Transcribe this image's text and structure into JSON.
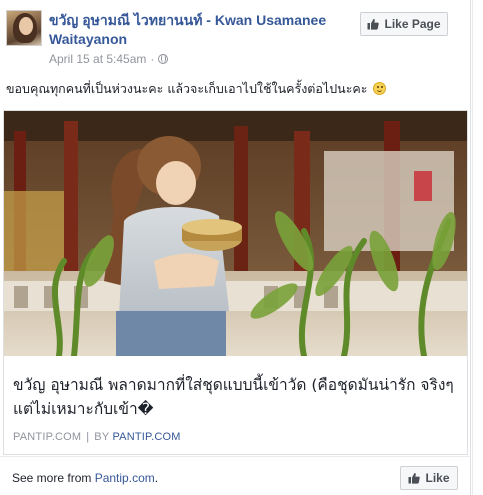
{
  "post": {
    "page_name": "ขวัญ อุษามณี ไวทยานนท์ - Kwan Usamanee Waitayanon",
    "timestamp": "April 15 at 5:45am",
    "meta_separator": "·",
    "privacy_icon": "globe-icon",
    "like_page_label": "Like Page",
    "text": "ขอบคุณทุกคนที่เป็นห่วงนะคะ แล้วจะเก็บเอาไปใช้ในครั้งต่อไปนะคะ",
    "text_emoji": "smiling-face-emoji"
  },
  "link_preview": {
    "title": "ขวัญ อุษามณี พลาดมากที่ใส่ชุดแบบนี้เข้าวัด (คือชุดมันน่ารัก จริงๆแต่ไม่เหมาะกับเข้า�",
    "domain": "PANTIP.COM",
    "separator": "|",
    "by_label": "BY",
    "by_domain": "PANTIP.COM"
  },
  "footer": {
    "see_more_prefix": "See more from",
    "see_more_link": "Pantip.com",
    "see_more_suffix": ".",
    "like_label": "Like"
  },
  "colors": {
    "link_blue": "#365899",
    "meta_gray": "#90949c",
    "button_bg": "#f6f7f9"
  }
}
